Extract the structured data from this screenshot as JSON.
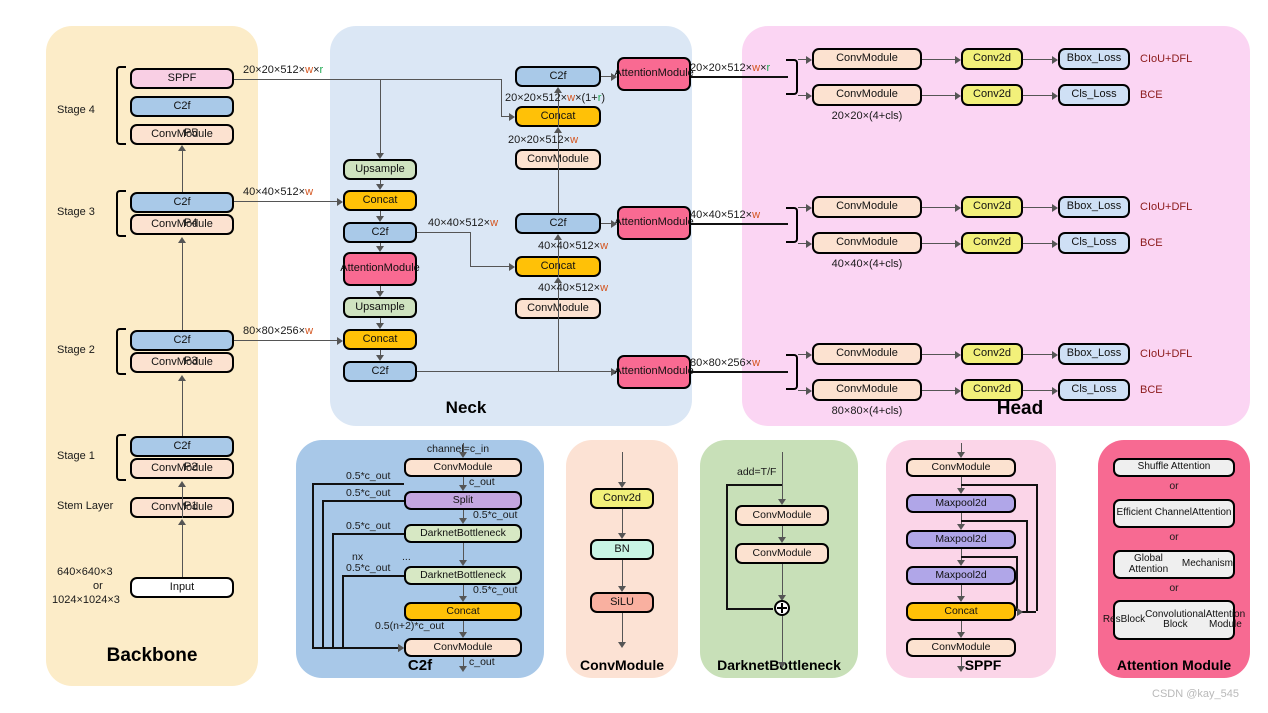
{
  "watermark": "CSDN @kay_545",
  "panels": {
    "backbone": {
      "title": "Backbone",
      "color": "#fcecc8"
    },
    "neck": {
      "title": "Neck",
      "color": "#dbe7f5"
    },
    "head": {
      "title": "Head",
      "color": "#fbd5f3"
    },
    "c2f": {
      "title": "C2f",
      "color": "#a8c8e8"
    },
    "convmodule": {
      "title": "ConvModule",
      "color": "#fce2d4"
    },
    "darknetbottleneck": {
      "title": "DarknetBottleneck",
      "color": "#c8e0b8"
    },
    "sppf": {
      "title": "SPPF",
      "color": "#fbd5e8"
    },
    "attention": {
      "title": "Attention Module",
      "color": "#f76a92"
    }
  },
  "colors": {
    "convmodule_box": "#fce2d0",
    "c2f_box": "#a9c9e8",
    "sppf_box": "#f9cfe4",
    "concat_box": "#ffc107",
    "upsample_box": "#cfe3c0",
    "attention_box": "#f96a92",
    "conv2d_box": "#f2f07a",
    "loss_box": "#cfe0f5",
    "split_box": "#c4a6e0",
    "maxpool_box": "#b0a6e8",
    "bn_box": "#c8f5e4",
    "silu_box": "#f9b0a0",
    "darknet_box": "#d7e8c4",
    "input_box": "#ffffff",
    "attn_option_box": "#efefef",
    "w_accent": "#d4541e",
    "r_accent": "#1aa84f",
    "loss_text": "#8b1a1a"
  },
  "backbone": {
    "stages": [
      {
        "name": "Stage 4",
        "boxes": [
          "SPPF",
          "C2f",
          "ConvModule"
        ],
        "pmark": "P5"
      },
      {
        "name": "Stage 3",
        "boxes": [
          "C2f",
          "ConvModule"
        ],
        "pmark": "P4"
      },
      {
        "name": "Stage 2",
        "boxes": [
          "C2f",
          "ConvModule"
        ],
        "pmark": "P3"
      },
      {
        "name": "Stage 1",
        "boxes": [
          "C2f",
          "ConvModule"
        ],
        "pmark": "P2"
      }
    ],
    "stem_label": "Stem Layer",
    "stem_box": "ConvModule",
    "stem_pmark": "P1",
    "input_box": "Input",
    "input_size_line1": "640×640×3",
    "input_size_line2": "or",
    "input_size_line3": "1024×1024×3"
  },
  "neck": {
    "left_column": [
      "Upsample",
      "Concat",
      "C2f",
      "Attention Module",
      "Upsample",
      "Concat",
      "C2f"
    ],
    "right_column": [
      "C2f",
      "Concat",
      "ConvModule",
      "C2f",
      "Concat",
      "ConvModule"
    ],
    "attention_boxes": [
      "Attention Module",
      "Attention Module",
      "Attention Module"
    ],
    "box_c2f_top": "C2f",
    "box_concat_top": "Concat",
    "box_conv_top": "ConvModule",
    "box_c2f_mid": "C2f",
    "box_concat_mid": "Concat",
    "box_conv_mid": "ConvModule"
  },
  "tensor_labels": {
    "p5_out": {
      "pre": "20×20×512×",
      "w": "w",
      "mid": "×",
      "r": "r"
    },
    "p4_out": {
      "pre": "40×40×512×",
      "w": "w"
    },
    "p3_out": {
      "pre": "80×80×256×",
      "w": "w"
    },
    "concat_top_out": {
      "pre": "20×20×512×",
      "w": "w",
      "mid": "×(1+",
      "r": "r",
      "post": ")"
    },
    "conv_top_out": {
      "pre": "20×20×512×",
      "w": "w"
    },
    "neck_mid_a": {
      "pre": "40×40×512×",
      "w": "w"
    },
    "neck_mid_b": {
      "pre": "40×40×512×",
      "w": "w"
    },
    "neck_mid_c": {
      "pre": "40×40×512×",
      "w": "w"
    },
    "head_in_20": {
      "pre": "20×20×512×",
      "w": "w",
      "mid": "×",
      "r": "r"
    },
    "head_in_40": {
      "pre": "40×40×512×",
      "w": "w"
    },
    "head_in_80": {
      "pre": "80×80×256×",
      "w": "w"
    }
  },
  "head": {
    "rows": [
      {
        "bbox_branch": {
          "conv": "ConvModule",
          "conv2d": "Conv2d",
          "loss": "Bbox_Loss",
          "loss_name": "CIoU+DFL"
        },
        "cls_branch": {
          "conv": "ConvModule",
          "conv2d": "Conv2d",
          "loss": "Cls_Loss",
          "loss_name": "BCE"
        },
        "out_shape": "20×20×(4+cls)"
      },
      {
        "bbox_branch": {
          "conv": "ConvModule",
          "conv2d": "Conv2d",
          "loss": "Bbox_Loss",
          "loss_name": "CIoU+DFL"
        },
        "cls_branch": {
          "conv": "ConvModule",
          "conv2d": "Conv2d",
          "loss": "Cls_Loss",
          "loss_name": "BCE"
        },
        "out_shape": "40×40×(4+cls)"
      },
      {
        "bbox_branch": {
          "conv": "ConvModule",
          "conv2d": "Conv2d",
          "loss": "Bbox_Loss",
          "loss_name": "CIoU+DFL"
        },
        "cls_branch": {
          "conv": "ConvModule",
          "conv2d": "Conv2d",
          "loss": "Cls_Loss",
          "loss_name": "BCE"
        },
        "out_shape": "80×80×(4+cls)"
      }
    ]
  },
  "c2f_detail": {
    "boxes": [
      "ConvModule",
      "Split",
      "DarknetBottleneck",
      "DarknetBottleneck",
      "Concat",
      "ConvModule"
    ],
    "in_label": "channel=c_in",
    "after_conv": "c_out",
    "half_1": "0.5*c_out",
    "half_2": "0.5*c_out",
    "half_3": "0.5*c_out",
    "half_4": "0.5*c_out",
    "split_out": "0.5*c_out",
    "bottleneck_out": "0.5*c_out",
    "concat_out": "0.5(n+2)*c_out",
    "repeat": "nx",
    "ellipsis": "...",
    "final_out": "c_out"
  },
  "convmodule_detail": {
    "boxes": [
      "Conv2d",
      "BN",
      "SiLU"
    ]
  },
  "darknet_detail": {
    "boxes": [
      "ConvModule",
      "ConvModule"
    ],
    "add_label": "add=T/F"
  },
  "sppf_detail": {
    "boxes": [
      "ConvModule",
      "Maxpool2d",
      "Maxpool2d",
      "Maxpool2d",
      "Concat",
      "ConvModule"
    ]
  },
  "attention_detail": {
    "options": [
      "Shuffle Attention",
      "Efficient Channel\nAttention",
      "Global Attention\nMechanism",
      "ResBlock\nConvolutional Block\nAttention Module"
    ],
    "separator": "or"
  }
}
